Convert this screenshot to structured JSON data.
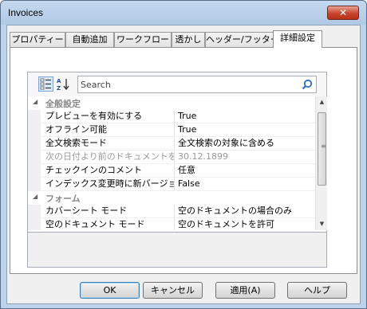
{
  "window": {
    "title": "Invoices",
    "close_glyph": "✕"
  },
  "tabs": [
    {
      "label": "プロパティー"
    },
    {
      "label": "自動追加"
    },
    {
      "label": "ワークフロー"
    },
    {
      "label": "透かし"
    },
    {
      "label": "ヘッダー/フッター"
    },
    {
      "label": "詳細設定",
      "active": true
    }
  ],
  "toolbar": {
    "categorized_icon": "categorized-view-icon",
    "alphabetical_icon": "alphabetical-sort-icon",
    "search_placeholder": "Search",
    "search_value": "",
    "search_icon": "magnifier-icon"
  },
  "grid": {
    "sections": [
      {
        "category": "全般設定",
        "rows": [
          {
            "name": "プレビューを有効にする",
            "value": "True"
          },
          {
            "name": "オフライン可能",
            "value": "True"
          },
          {
            "name": "全文検索モード",
            "value": "全文検索の対象に含める"
          },
          {
            "name": "次の日付より前のドキュメントを...",
            "value": "30.12.1899",
            "disabled": true
          },
          {
            "name": "チェックインのコメント",
            "value": "任意"
          },
          {
            "name": "インデックス変更時に新バージョ...",
            "value": "False"
          }
        ]
      },
      {
        "category": "フォーム",
        "rows": [
          {
            "name": "カバーシート モード",
            "value": "空のドキュメントの場合のみ"
          },
          {
            "name": "空のドキュメント モード",
            "value": "空のドキュメントを許可"
          }
        ]
      }
    ],
    "description": ""
  },
  "buttons": {
    "ok": "OK",
    "cancel": "キャンセル",
    "apply": "適用(A)",
    "help": "ヘルプ"
  }
}
